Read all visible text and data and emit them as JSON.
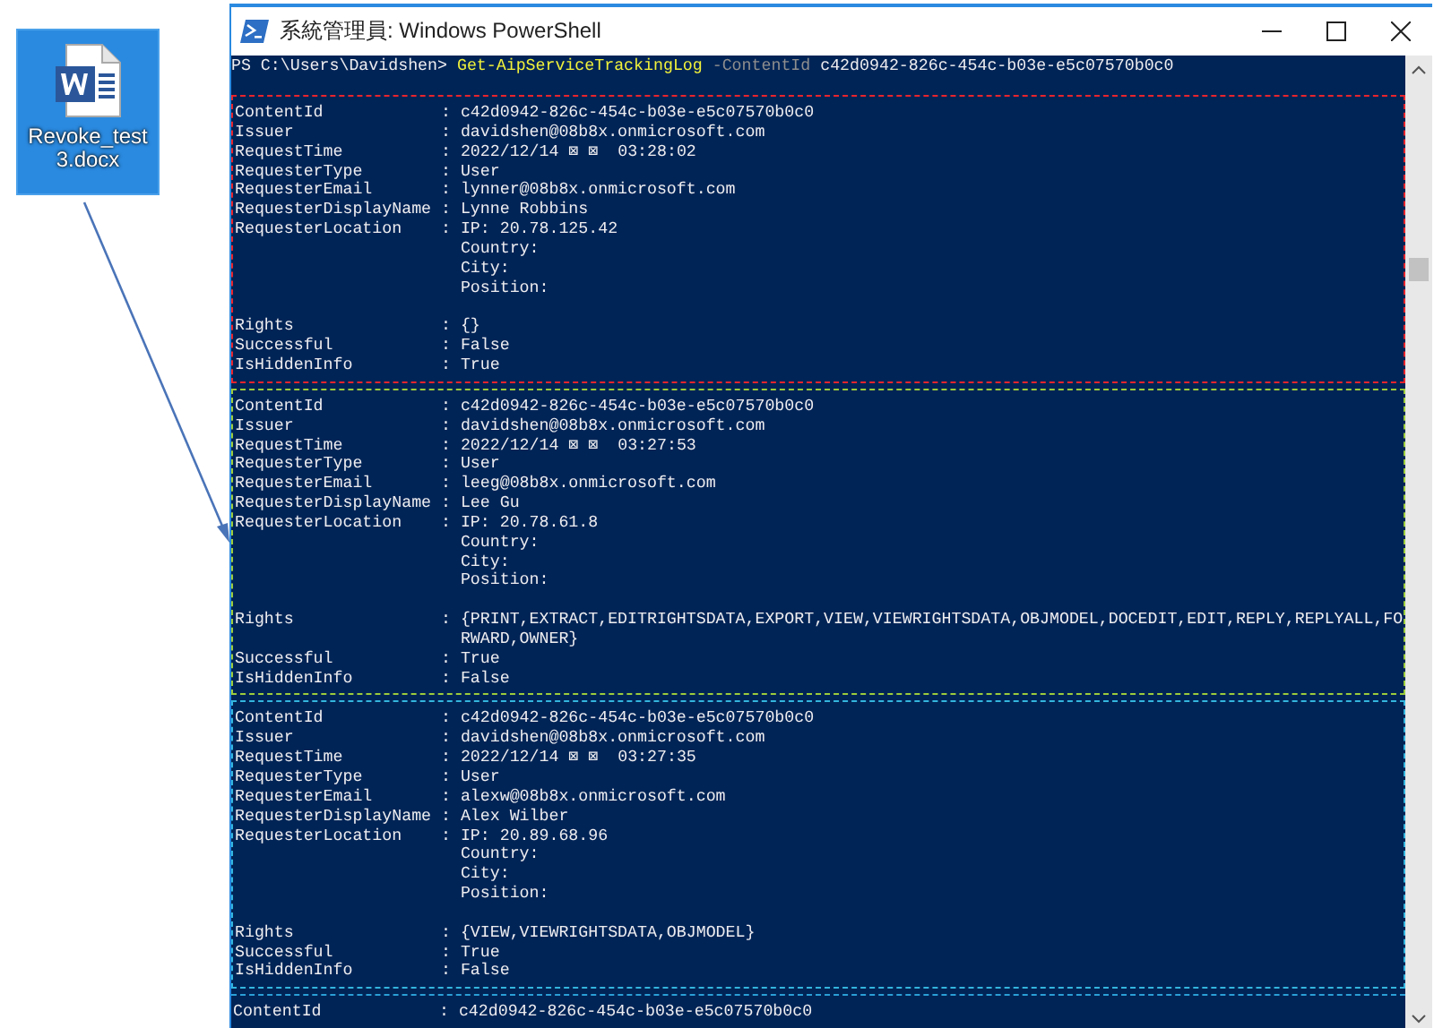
{
  "desktop_icon": {
    "label_lines": [
      "Revoke_test",
      "3.docx"
    ],
    "selected": true
  },
  "window": {
    "title": "系統管理員: Windows PowerShell"
  },
  "console": {
    "separator": ":",
    "command_tokens": [
      {
        "kind": "prompt",
        "text": "PS C:\\Users\\Davidshen>"
      },
      {
        "kind": "cmdlet",
        "text": "Get-AipServiceTrackingLog"
      },
      {
        "kind": "parameter",
        "text": "-ContentId"
      },
      {
        "kind": "argument",
        "text": "c42d0942-826c-454c-b03e-e5c07570b0c0"
      }
    ],
    "blocks": [
      {
        "color": "#e8242c",
        "rows": [
          {
            "kind": "field",
            "key": "ContentId",
            "lines": [
              "c42d0942-826c-454c-b03e-e5c07570b0c0"
            ]
          },
          {
            "kind": "field",
            "key": "Issuer",
            "lines": [
              "davidshen@08b8x.onmicrosoft.com"
            ]
          },
          {
            "kind": "field",
            "key": "RequestTime",
            "lines": [
              "2022/12/14 ⊠ ⊠  03:28:02"
            ]
          },
          {
            "kind": "field",
            "key": "RequesterType",
            "lines": [
              "User"
            ]
          },
          {
            "kind": "field",
            "key": "RequesterEmail",
            "lines": [
              "lynner@08b8x.onmicrosoft.com"
            ]
          },
          {
            "kind": "field",
            "key": "RequesterDisplayName",
            "lines": [
              "Lynne Robbins"
            ]
          },
          {
            "kind": "field",
            "key": "RequesterLocation",
            "lines": [
              "IP: 20.78.125.42",
              "Country:",
              "City:",
              "Position:"
            ]
          },
          {
            "kind": "spacer"
          },
          {
            "kind": "field",
            "key": "Rights",
            "lines": [
              "{}"
            ]
          },
          {
            "kind": "field",
            "key": "Successful",
            "lines": [
              "False"
            ]
          },
          {
            "kind": "field",
            "key": "IsHiddenInfo",
            "lines": [
              "True"
            ]
          }
        ]
      },
      {
        "color": "#9ccc3c",
        "rows": [
          {
            "kind": "field",
            "key": "ContentId",
            "lines": [
              "c42d0942-826c-454c-b03e-e5c07570b0c0"
            ]
          },
          {
            "kind": "field",
            "key": "Issuer",
            "lines": [
              "davidshen@08b8x.onmicrosoft.com"
            ]
          },
          {
            "kind": "field",
            "key": "RequestTime",
            "lines": [
              "2022/12/14 ⊠ ⊠  03:27:53"
            ]
          },
          {
            "kind": "field",
            "key": "RequesterType",
            "lines": [
              "User"
            ]
          },
          {
            "kind": "field",
            "key": "RequesterEmail",
            "lines": [
              "leeg@08b8x.onmicrosoft.com"
            ]
          },
          {
            "kind": "field",
            "key": "RequesterDisplayName",
            "lines": [
              "Lee Gu"
            ]
          },
          {
            "kind": "field",
            "key": "RequesterLocation",
            "lines": [
              "IP: 20.78.61.8",
              "Country:",
              "City:",
              "Position:"
            ]
          },
          {
            "kind": "spacer"
          },
          {
            "kind": "field",
            "key": "Rights",
            "lines": [
              "{PRINT,EXTRACT,EDITRIGHTSDATA,EXPORT,VIEW,VIEWRIGHTSDATA,OBJMODEL,DOCEDIT,EDIT,REPLY,REPLYALL,FO",
              "RWARD,OWNER}"
            ]
          },
          {
            "kind": "field",
            "key": "Successful",
            "lines": [
              "True"
            ]
          },
          {
            "kind": "field",
            "key": "IsHiddenInfo",
            "lines": [
              "False"
            ]
          }
        ]
      },
      {
        "color": "#33b5de",
        "rows": [
          {
            "kind": "field",
            "key": "ContentId",
            "lines": [
              "c42d0942-826c-454c-b03e-e5c07570b0c0"
            ]
          },
          {
            "kind": "field",
            "key": "Issuer",
            "lines": [
              "davidshen@08b8x.onmicrosoft.com"
            ]
          },
          {
            "kind": "field",
            "key": "RequestTime",
            "lines": [
              "2022/12/14 ⊠ ⊠  03:27:35"
            ]
          },
          {
            "kind": "field",
            "key": "RequesterType",
            "lines": [
              "User"
            ]
          },
          {
            "kind": "field",
            "key": "RequesterEmail",
            "lines": [
              "alexw@08b8x.onmicrosoft.com"
            ]
          },
          {
            "kind": "field",
            "key": "RequesterDisplayName",
            "lines": [
              "Alex Wilber"
            ]
          },
          {
            "kind": "field",
            "key": "RequesterLocation",
            "lines": [
              "IP: 20.89.68.96",
              "Country:",
              "City:",
              "Position:"
            ]
          },
          {
            "kind": "spacer"
          },
          {
            "kind": "field",
            "key": "Rights",
            "lines": [
              "{VIEW,VIEWRIGHTSDATA,OBJMODEL}"
            ]
          },
          {
            "kind": "field",
            "key": "Successful",
            "lines": [
              "True"
            ]
          },
          {
            "kind": "field",
            "key": "IsHiddenInfo",
            "lines": [
              "False"
            ]
          }
        ]
      },
      {
        "color": "#2a9fd6",
        "rows": [
          {
            "kind": "field",
            "key": "ContentId",
            "lines": [
              "c42d0942-826c-454c-b03e-e5c07570b0c0"
            ]
          }
        ]
      }
    ]
  }
}
